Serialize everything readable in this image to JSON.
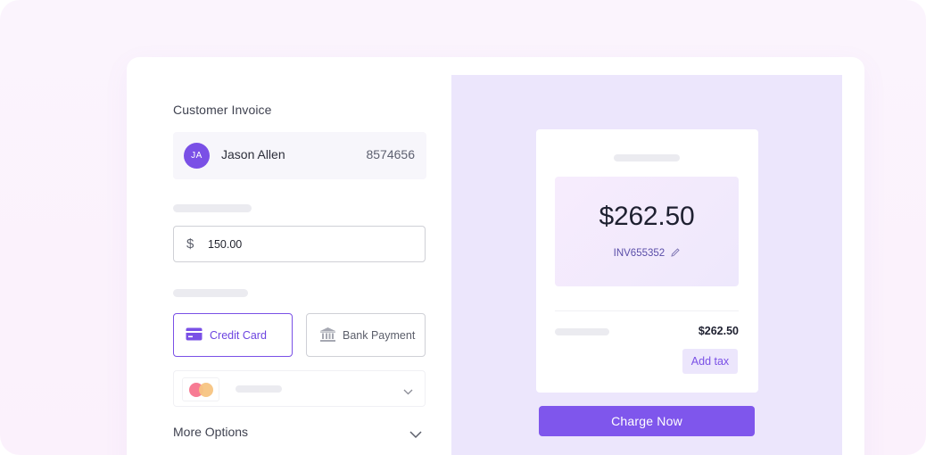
{
  "invoice_form": {
    "title": "Customer Invoice",
    "customer": {
      "initials": "JA",
      "name": "Jason Allen",
      "number": "8574656"
    },
    "amount": {
      "currency_symbol": "$",
      "value": "150.00"
    },
    "payment_methods": [
      {
        "label": "Credit Card",
        "icon": "credit-card-icon",
        "selected": true
      },
      {
        "label": "Bank Payment",
        "icon": "bank-icon",
        "selected": false
      }
    ],
    "card_select": {
      "icon": "mastercard-icon"
    },
    "more_options_label": "More Options"
  },
  "summary": {
    "total_amount": "$262.50",
    "invoice_number": "INV655352",
    "line_total": "$262.50",
    "add_tax_label": "Add tax",
    "charge_label": "Charge Now"
  },
  "colors": {
    "accent": "#7f56ec",
    "accent_light": "#ece6fc",
    "background": "#fbf4fd"
  }
}
